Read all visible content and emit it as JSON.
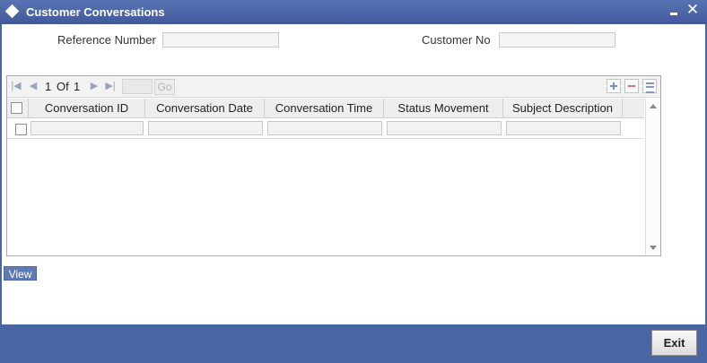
{
  "window": {
    "title": "Customer Conversations",
    "close_glyph": "✕"
  },
  "form": {
    "reference_number_label": "Reference Number",
    "reference_number_value": "",
    "customer_no_label": "Customer No",
    "customer_no_value": ""
  },
  "grid": {
    "pagination": {
      "current": "1",
      "of_label": "Of",
      "total": "1",
      "page_input_value": "",
      "go_label": "Go"
    },
    "columns": [
      "Conversation ID",
      "Conversation Date",
      "Conversation Time",
      "Status Movement",
      "Subject Description"
    ],
    "rows": [
      [
        "",
        "",
        "",
        "",
        ""
      ]
    ]
  },
  "buttons": {
    "view_label": "View",
    "exit_label": "Exit"
  },
  "icons": {
    "first_page": "first-page-icon",
    "prev_page": "prev-page-icon",
    "next_page": "next-page-icon",
    "last_page": "last-page-icon",
    "add_row": "plus-icon",
    "delete_row": "minus-icon",
    "columns": "columns-icon"
  },
  "colors": {
    "frame": "#4a65a3",
    "title_text": "#ffffff",
    "header_bg": "#eeeeee"
  }
}
